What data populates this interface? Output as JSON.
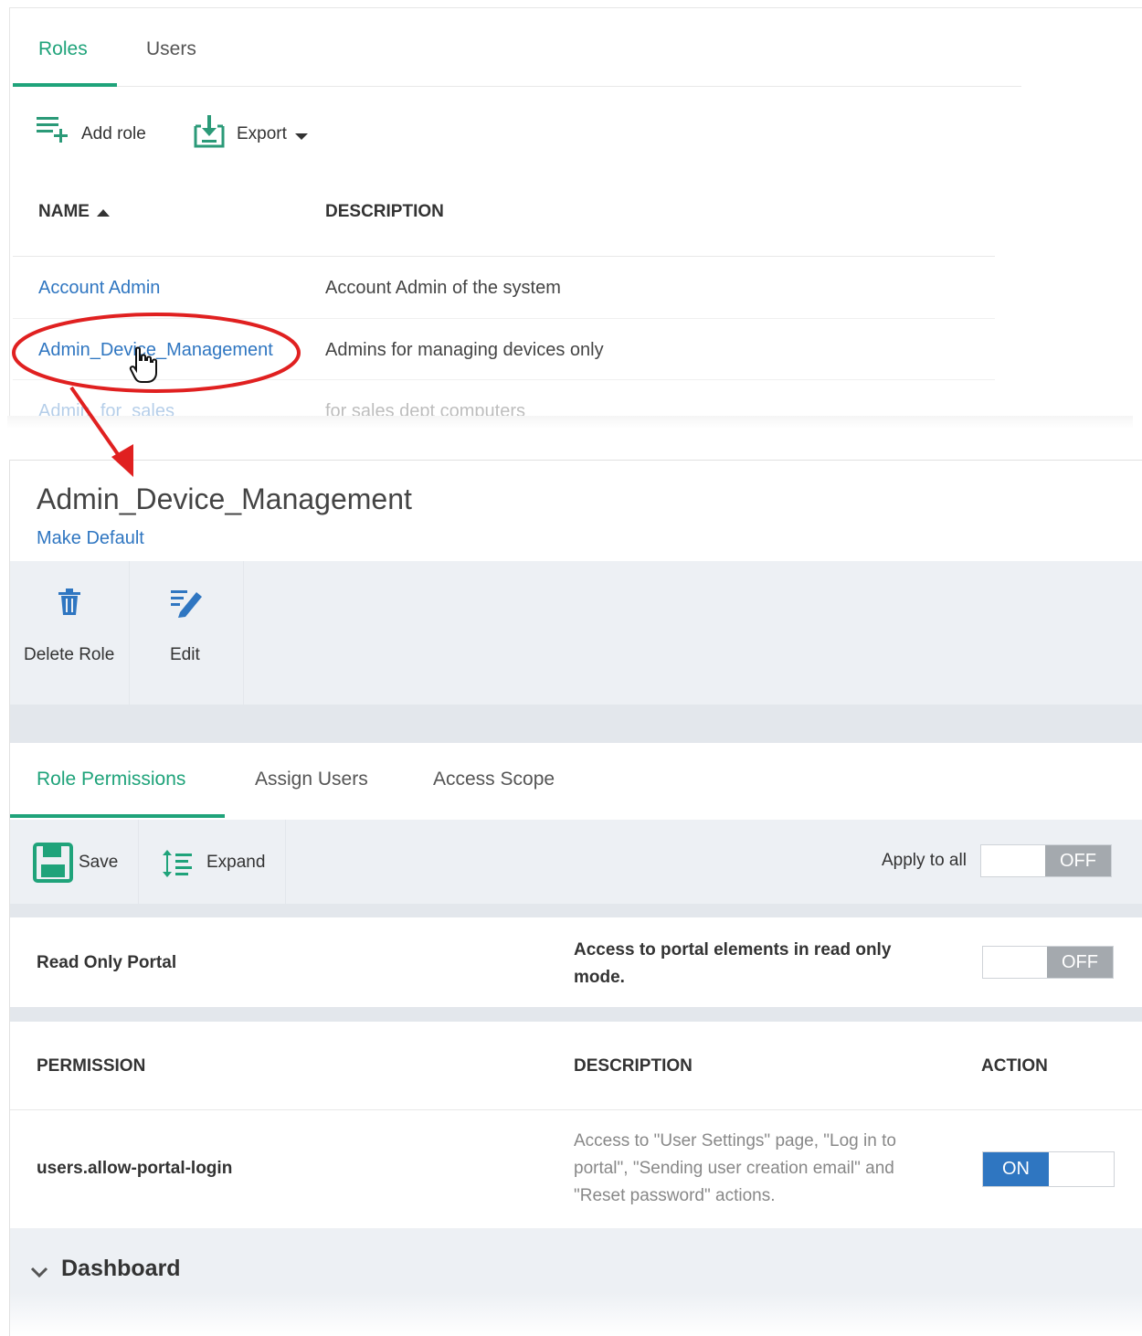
{
  "top": {
    "tabs": [
      {
        "label": "Roles",
        "active": true
      },
      {
        "label": "Users",
        "active": false
      }
    ],
    "toolbar": {
      "add_role_label": "Add role",
      "export_label": "Export"
    },
    "table": {
      "headers": {
        "name": "NAME",
        "description": "DESCRIPTION"
      },
      "rows": [
        {
          "name": "Account Admin",
          "description": "Account Admin of the system"
        },
        {
          "name": "Admin_Device_Management",
          "description": "Admins for managing devices only"
        },
        {
          "name": "Admin_for_sales",
          "description": "for sales dept computers"
        }
      ]
    }
  },
  "detail": {
    "title": "Admin_Device_Management",
    "make_default_label": "Make Default",
    "actions": {
      "delete_label": "Delete Role",
      "edit_label": "Edit"
    },
    "tabs": [
      {
        "label": "Role Permissions",
        "active": true
      },
      {
        "label": "Assign Users",
        "active": false
      },
      {
        "label": "Access Scope",
        "active": false
      }
    ],
    "toolbar": {
      "save_label": "Save",
      "expand_label": "Expand",
      "apply_all_label": "Apply to all",
      "apply_all_state": "OFF"
    },
    "read_only": {
      "label": "Read Only Portal",
      "description": "Access to portal elements in read only mode.",
      "state": "OFF"
    },
    "permissions_table": {
      "headers": {
        "permission": "PERMISSION",
        "description": "DESCRIPTION",
        "action": "ACTION"
      },
      "rows": [
        {
          "permission": "users.allow-portal-login",
          "description": "Access to \"User Settings\" page, \"Log in to portal\", \"Sending user creation email\" and \"Reset password\" actions.",
          "state": "ON"
        }
      ]
    },
    "section": {
      "label": "Dashboard"
    }
  },
  "colors": {
    "accent": "#1fa37a",
    "link": "#2f76c1",
    "annotation": "#e02020",
    "toggle_off": "#a4a9ae",
    "toggle_on": "#2f76c1"
  }
}
